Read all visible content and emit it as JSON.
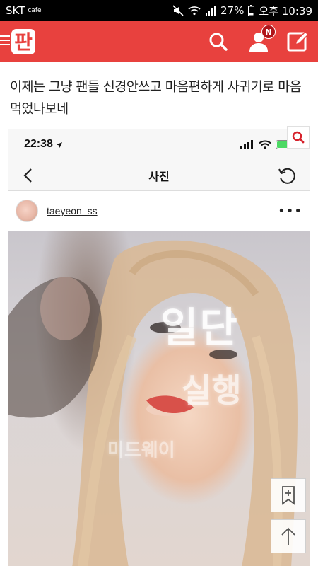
{
  "status_bar": {
    "carrier": "SKT",
    "carrier_sub": "cafe",
    "battery": "27%",
    "time": "오후 10:39"
  },
  "app": {
    "logo_text": "판",
    "notification_badge": "N",
    "accent_color": "#e8413e"
  },
  "post": {
    "title": "이제는 그냥 팬들 신경안쓰고 마음편하게 사귀기로 마음먹었나보네"
  },
  "embedded_screenshot": {
    "ios_time": "22:38",
    "nav_title": "사진",
    "username": "taeyeon_ss",
    "more_label": "•••",
    "projected_text_1": "일단",
    "projected_text_2": "실행",
    "projected_text_3": "미드웨이"
  },
  "icons": {
    "search": "search-icon",
    "user": "user-icon",
    "write": "write-icon",
    "bookmark": "bookmark-add-icon",
    "scroll_top": "arrow-up-icon"
  }
}
